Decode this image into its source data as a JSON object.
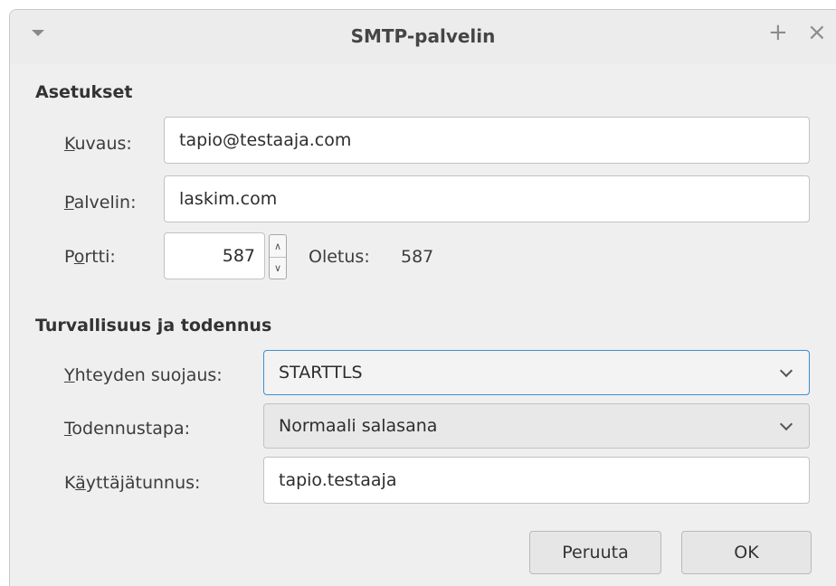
{
  "window": {
    "title": "SMTP-palvelin"
  },
  "settings": {
    "heading": "Asetukset",
    "description": {
      "label_key": "K",
      "label_rest": "uvaus:",
      "value": "tapio@testaaja.com"
    },
    "server": {
      "label_key": "P",
      "label_rest": "alvelin:",
      "value": "laskim.com"
    },
    "port": {
      "label_pre": "P",
      "label_key": "o",
      "label_rest": "rtti:",
      "value": "587",
      "default_label": "Oletus:",
      "default_value": "587"
    }
  },
  "security": {
    "heading": "Turvallisuus ja todennus",
    "connection": {
      "label_key": "Y",
      "label_rest": "hteyden suojaus:",
      "selected": "STARTTLS"
    },
    "auth": {
      "label_key": "T",
      "label_rest": "odennustapa:",
      "selected": "Normaali salasana"
    },
    "username": {
      "label_pre": "K",
      "label_key": "ä",
      "label_rest": "yttäjätunnus:",
      "value": "tapio.testaaja"
    }
  },
  "buttons": {
    "cancel": "Peruuta",
    "ok": "OK"
  },
  "colors": {
    "focus": "#3d8fd1",
    "background": "#efefef"
  }
}
